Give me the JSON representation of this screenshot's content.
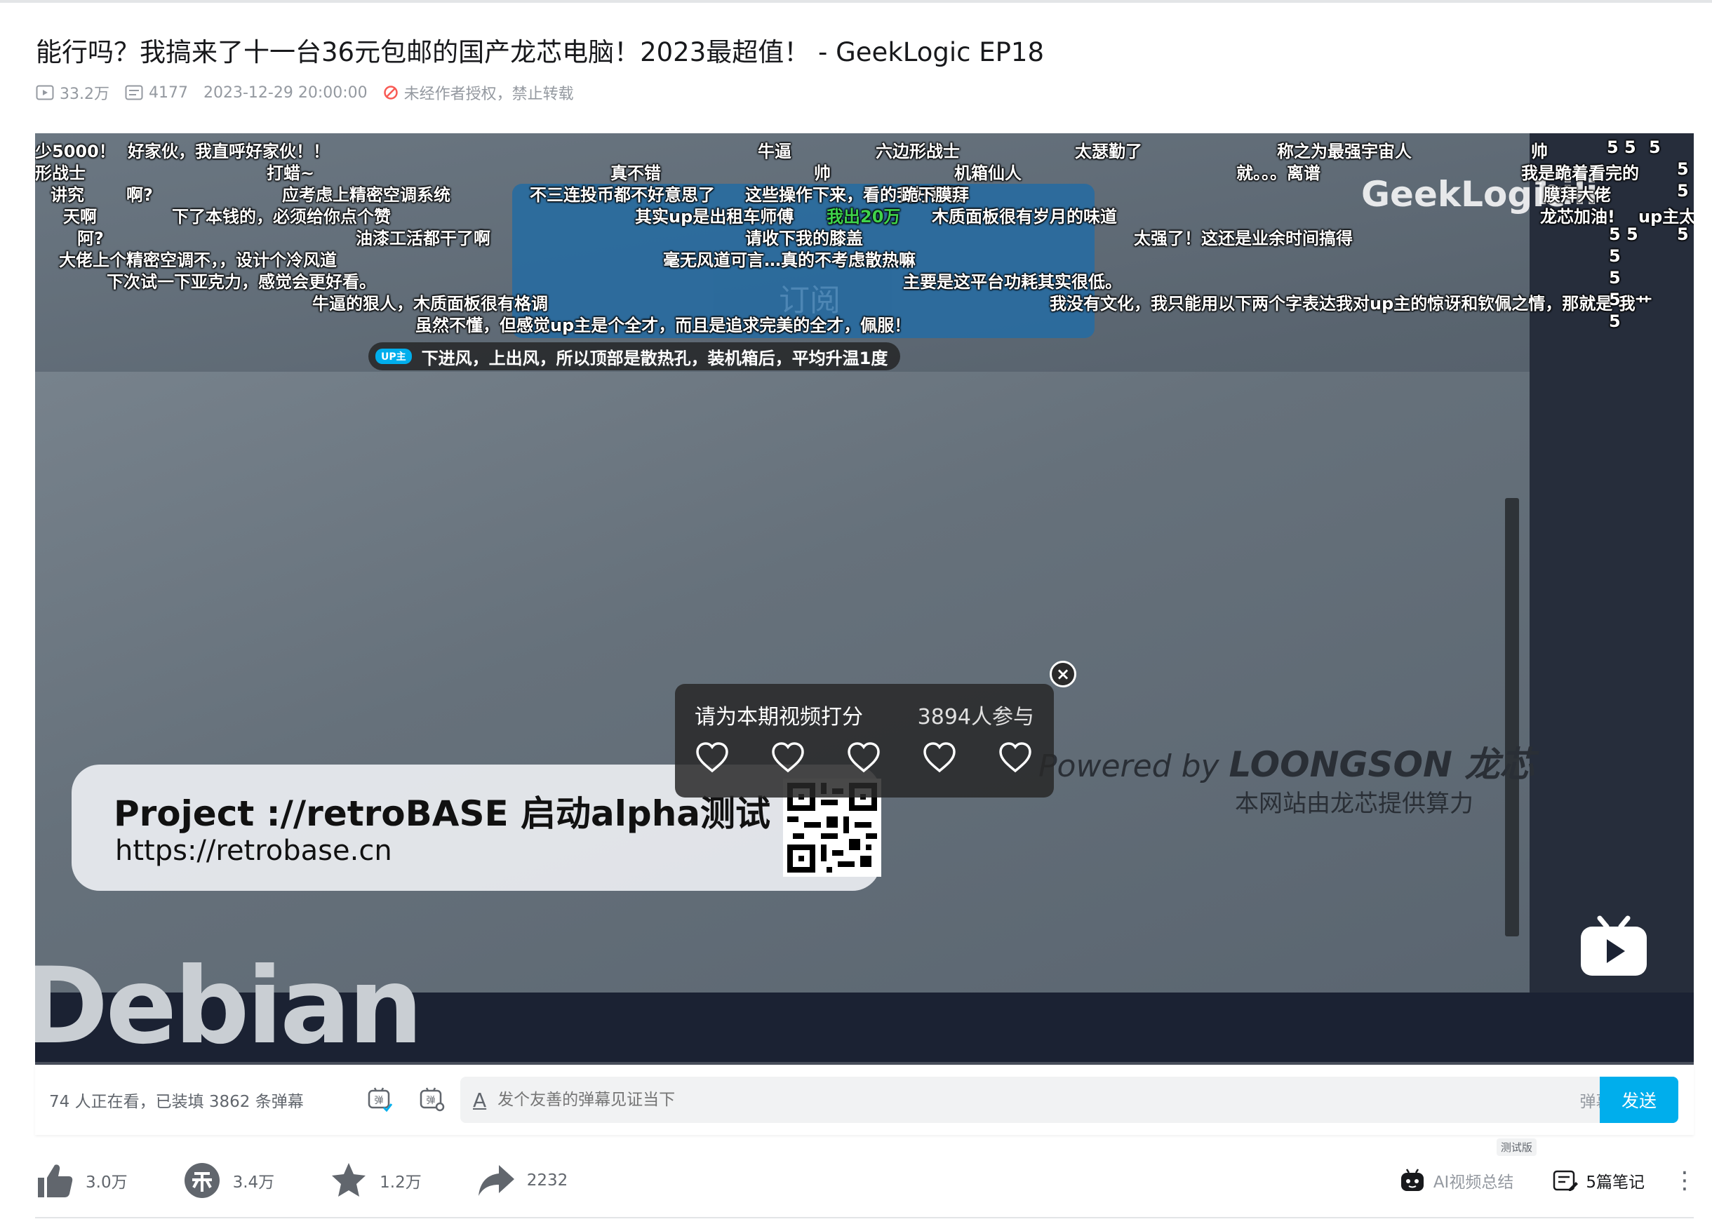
{
  "title": "能行吗？我搞来了十一台36元包邮的国产龙芯电脑！2023最超值！ - GeekLogic EP18",
  "meta": {
    "views": "33.2万",
    "danmaku_count": "4177",
    "publish_time": "2023-12-29 20:00:00",
    "copyright": "未经作者授权，禁止转载"
  },
  "video": {
    "watermark": "GeekLogic",
    "bili_mark": "bili",
    "screen_text": "订阅",
    "bottom_text": "Debian",
    "loongson_prefix": "Powered by ",
    "loongson_brand": "LOONGSON 龙芯",
    "loongson_sub": "本网站由龙芯提供算力",
    "promo_title": "Project ://retroBASE 启动alpha测试",
    "promo_url": "https://retrobase.cn",
    "progress_fraction": 0.0
  },
  "danmaku": [
    "少5000！",
    "好家伙，我直呼好家伙！！",
    "牛逼",
    "六边形战士",
    "太瑟勤了",
    "称之为最强宇宙人",
    "帅",
    "5 5",
    "5",
    "形战士",
    "打蜡~",
    "真不错",
    "帅",
    "机箱仙人",
    "就。。。离谱",
    "我是跪着看完的",
    "5",
    "讲究",
    "啊?",
    "应考虑上精密空调系统",
    "不三连投币都不好意思了",
    "这些操作下来，看的我好舒服",
    "跪下膜拜",
    "膜拜大佬",
    "5",
    "天啊",
    "下了本钱的，必须给你点个赞",
    "其实up是出租车师傅",
    "我出20万",
    "木质面板很有岁月的味道",
    "龙芯加油!",
    "up主太",
    "阿?",
    "油漆工活都干了啊",
    "请收下我的膝盖",
    "太强了！这还是业余时间搞得",
    "5 5",
    "5",
    "大佬上个精密空调不，，设计个冷风道",
    "毫无风道可言…真的不考虑散热嘛",
    "5",
    "下次试一下亚克力，感觉会更好看。",
    "主要是这平台功耗其实很低。",
    "5",
    "牛逼的狠人，木质面板很有格调",
    "我没有文化，我只能用以下两个字表达我对up主的惊讶和钦佩之情，那就是 我艹",
    "5",
    "虽然不懂，但感觉up主是个全才，而且是追求完美的全才，佩服！",
    "5"
  ],
  "up_danmaku": {
    "tag": "UP主",
    "text": "下进风，上出风，所以顶部是散热孔，装机箱后，平均升温1度"
  },
  "rating": {
    "question": "请为本期视频打分",
    "participants": "3894人参与",
    "hearts": 5,
    "close": "×"
  },
  "sendbar": {
    "watching": "74 人正在看，已装填 3862 条弹幕",
    "input_placeholder": "发个友善的弹幕见证当下",
    "etiquette": "弹幕礼仪 ›",
    "send": "发送",
    "a_icon": "A"
  },
  "toolbar": {
    "like": "3.0万",
    "coin": "3.4万",
    "favorite": "1.2万",
    "share": "2232",
    "ai_summary": "AI视频总结",
    "beta": "测试版",
    "notes": "5篇笔记",
    "more": "⋮"
  },
  "colors": {
    "accent": "#00aeec",
    "text_primary": "#18191c",
    "text_secondary": "#61666d",
    "text_muted": "#9499a0",
    "warning": "#f85a54"
  }
}
